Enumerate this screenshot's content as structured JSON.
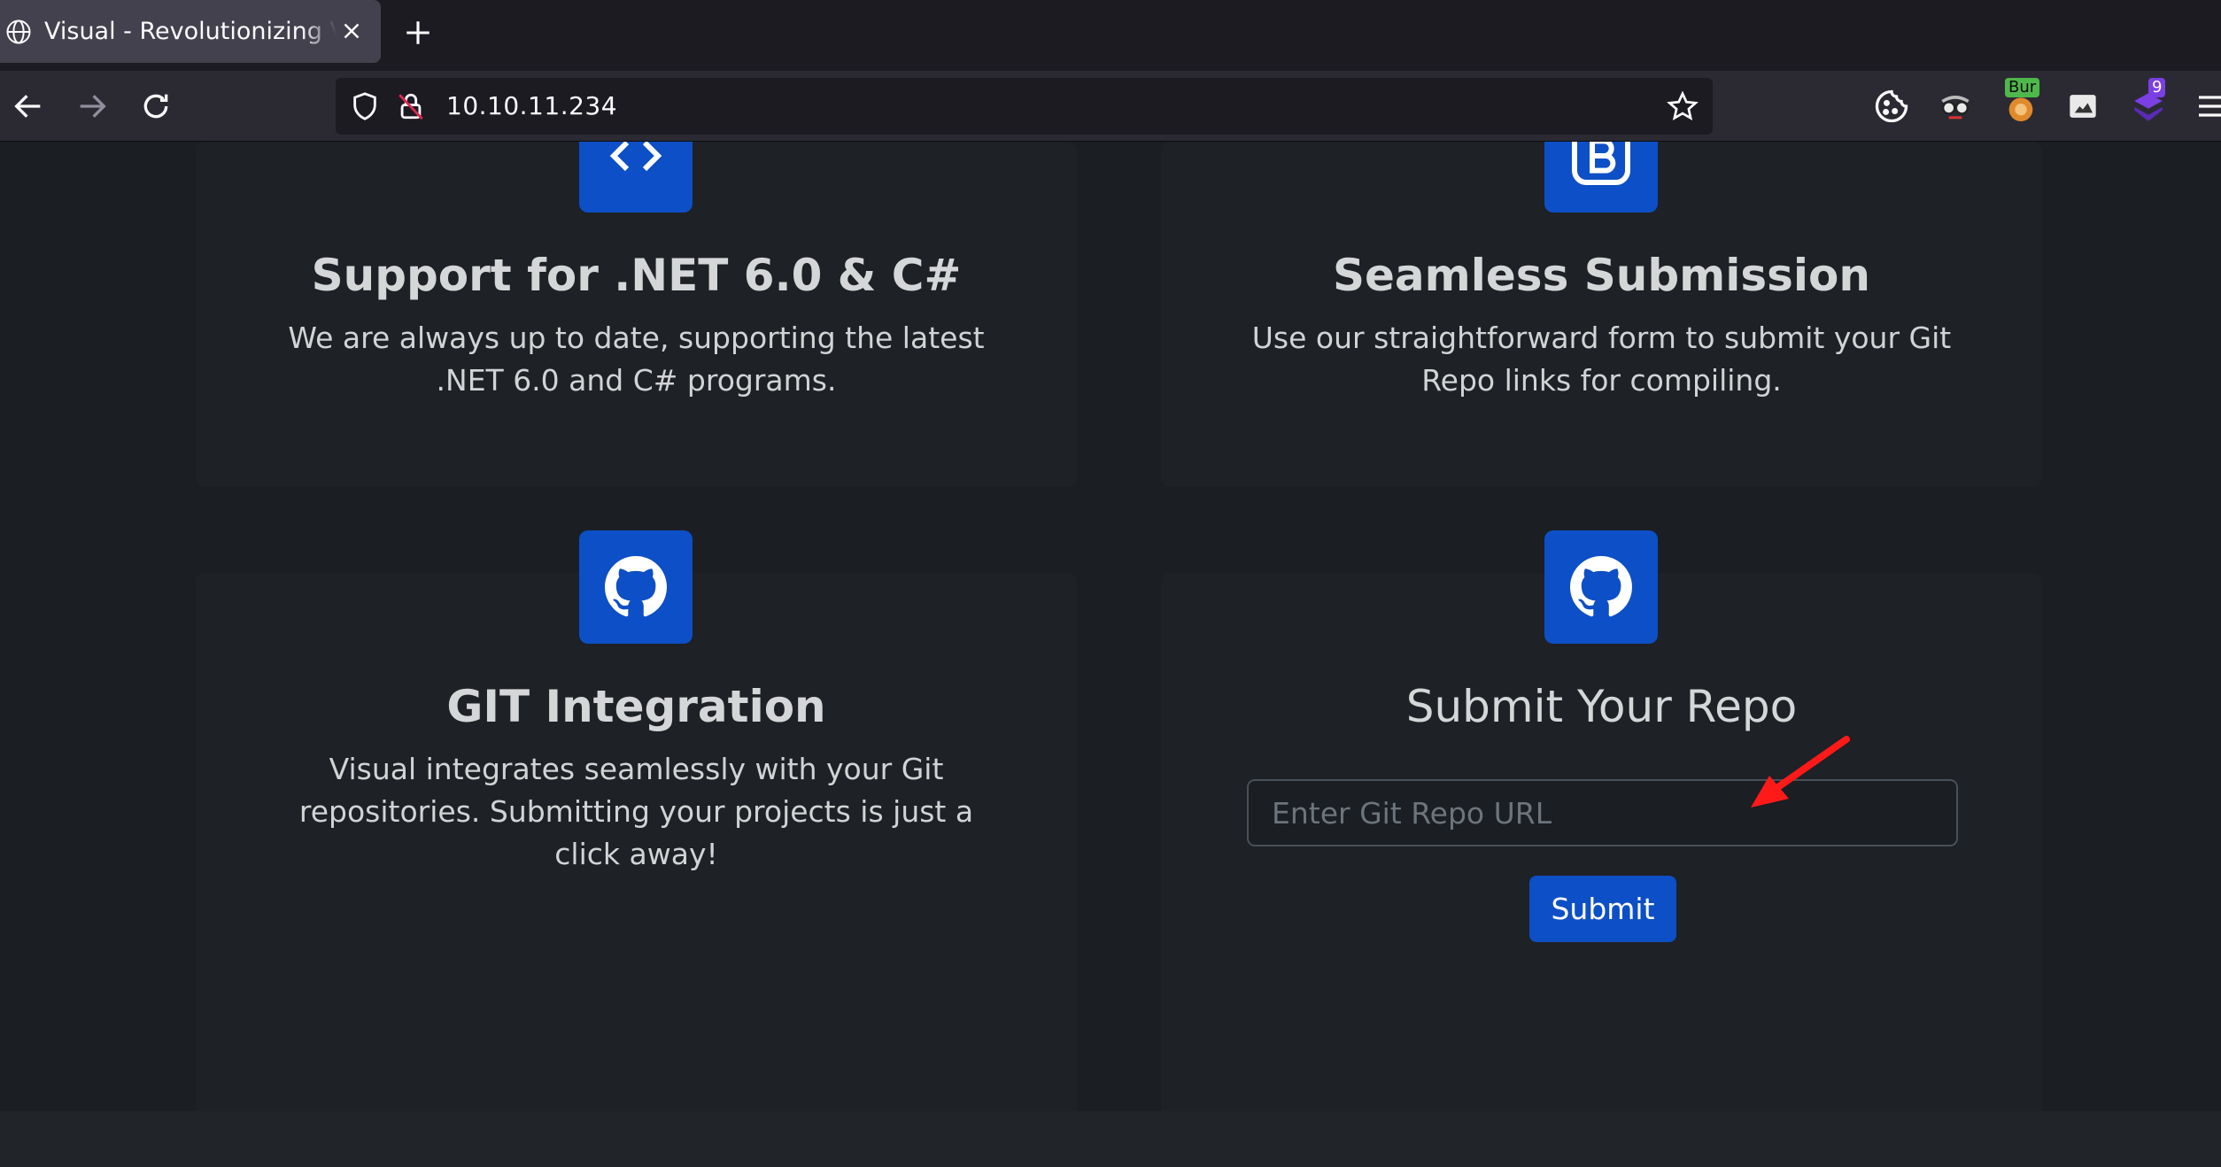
{
  "browser": {
    "tab_title": "Visual - Revolutionizing Visual Studio Builds",
    "url": "10.10.11.234",
    "extensions": [
      {
        "icon": "cookie-icon"
      },
      {
        "icon": "spy-glasses-icon"
      },
      {
        "icon": "burp-proxy-icon",
        "badge": "Bur"
      },
      {
        "icon": "image-extension-icon"
      },
      {
        "icon": "hacktools-icon",
        "badge": "9"
      }
    ]
  },
  "cards": {
    "dotnet": {
      "title": "Support for .NET 6.0 & C#",
      "line1": "We are always up to date, supporting the latest",
      "line2": ".NET 6.0 and C# programs."
    },
    "submission": {
      "title": "Seamless Submission",
      "line1": "Use our straightforward form to submit your Git",
      "line2": "Repo links for compiling."
    },
    "git": {
      "title": "GIT Integration",
      "line1": "Visual integrates seamlessly with your Git",
      "line2": "repositories. Submitting your projects is just a",
      "line3": "click away!"
    },
    "submit": {
      "title": "Submit Your Repo",
      "input_placeholder": "Enter Git Repo URL",
      "input_value": "",
      "button_label": "Submit"
    }
  },
  "colors": {
    "accent": "#0d4fc6",
    "page_bg": "#1b1e22",
    "annotation_arrow": "#ff1a1a"
  }
}
